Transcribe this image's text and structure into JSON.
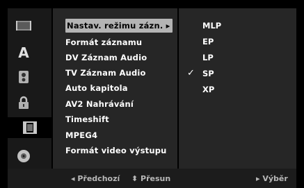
{
  "side_icons": [
    "film-strip-icon",
    "letter-a-icon",
    "disc-speaker-icon",
    "padlock-icon",
    "film-frame-icon",
    "disc-icon"
  ],
  "selected_icon": "film-frame-icon",
  "menu": {
    "items": [
      "Nastav. režimu zázn.",
      "Formát záznamu",
      "DV Záznam Audio",
      "TV Záznam Audio",
      "Auto kapitola",
      "AV2 Nahrávání",
      "Timeshift",
      "MPEG4",
      "Formát video výstupu"
    ],
    "active_arrow": "▸"
  },
  "options": {
    "items": [
      "MLP",
      "EP",
      "LP",
      "SP",
      "XP"
    ],
    "checked": "SP",
    "check_mark": "✓"
  },
  "footer": {
    "prev": "◂ Předchozí",
    "move": "⬍ Přesun",
    "select": "▸ Výběr"
  }
}
